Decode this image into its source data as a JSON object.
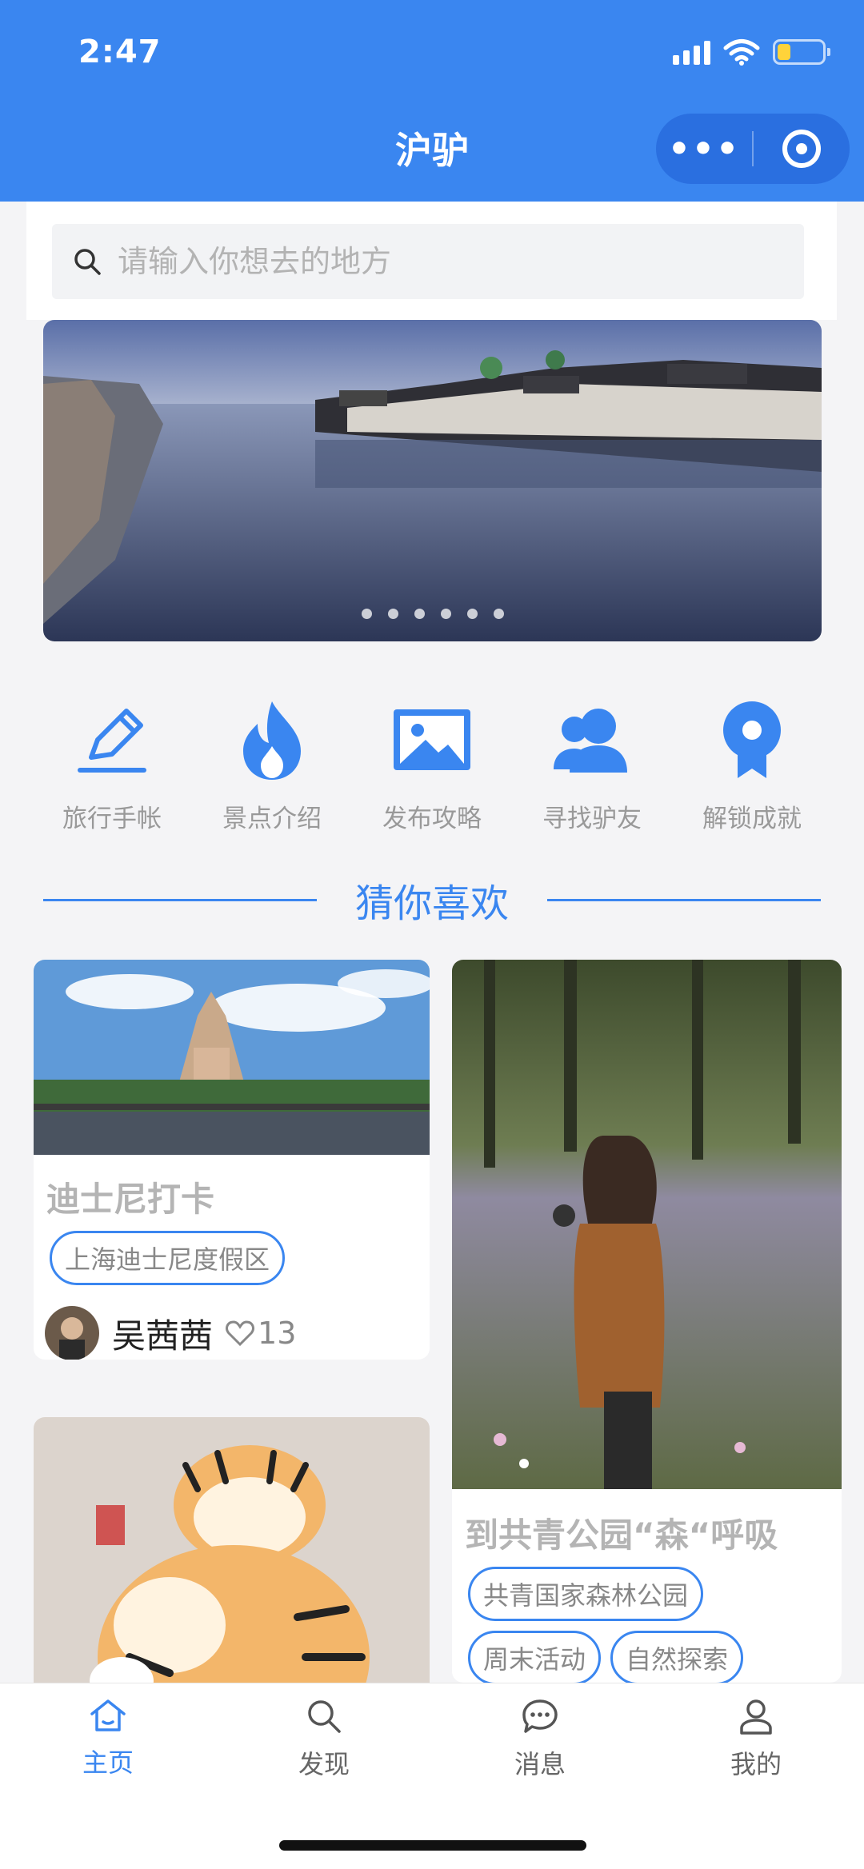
{
  "status_bar": {
    "time": "2:47"
  },
  "header": {
    "title": "沪驴",
    "more_icon": "more-dots-icon",
    "target_icon": "target-icon"
  },
  "search": {
    "placeholder": "请输入你想去的地方",
    "icon": "search-icon"
  },
  "banner": {
    "slide_count": 6,
    "active_index": 0
  },
  "quick_links": [
    {
      "label": "旅行手帐",
      "icon": "pencil-icon"
    },
    {
      "label": "景点介绍",
      "icon": "flame-icon"
    },
    {
      "label": "发布攻略",
      "icon": "image-icon"
    },
    {
      "label": "寻找驴友",
      "icon": "users-icon"
    },
    {
      "label": "解锁成就",
      "icon": "medal-icon"
    }
  ],
  "section": {
    "title": "猜你喜欢"
  },
  "cards": [
    {
      "title": "迪士尼打卡",
      "tags": [
        "上海迪士尼度假区"
      ],
      "author": "吴茜茜",
      "likes": "13"
    },
    {
      "title": "到共青公园“森“呼吸",
      "tags": [
        "共青国家森林公园",
        "周末活动",
        "自然探索"
      ]
    }
  ],
  "tabbar": {
    "tabs": [
      {
        "label": "主页",
        "icon": "home-icon",
        "active": true
      },
      {
        "label": "发现",
        "icon": "search-icon",
        "active": false
      },
      {
        "label": "消息",
        "icon": "chat-icon",
        "active": false
      },
      {
        "label": "我的",
        "icon": "user-icon",
        "active": false
      }
    ]
  },
  "colors": {
    "accent": "#3a86f0",
    "header_bg": "#3a86f0"
  }
}
